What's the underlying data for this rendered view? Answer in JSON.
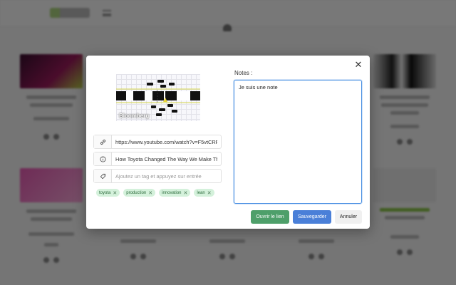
{
  "modal": {
    "close_glyph": "✕",
    "notes_label": "Notes :",
    "notes_value": "Je suis une note",
    "url_value": "https://www.youtube.com/watch?v=F5vtCRFR",
    "title_value": "How Toyota Changed The Way We Make Thin",
    "tag_placeholder": "Ajoutez un tag et appuyez sur entrée",
    "thumbnail_watermark": "Bloomberg",
    "tags": [
      {
        "label": "toyota"
      },
      {
        "label": "production"
      },
      {
        "label": "innovation"
      },
      {
        "label": "lean"
      }
    ],
    "tag_remove_glyph": "✕",
    "buttons": {
      "open": "Ouvrir le lien",
      "save": "Sauvegarder",
      "cancel": "Annuler"
    },
    "icons": {
      "url": "link-icon",
      "title": "info-icon",
      "tag": "tag-icon"
    }
  },
  "colors": {
    "open_button": "#4e9f6a",
    "save_button": "#4a7fd8",
    "tag_bg": "#d4f1db",
    "focus_border": "#4a90e2"
  }
}
